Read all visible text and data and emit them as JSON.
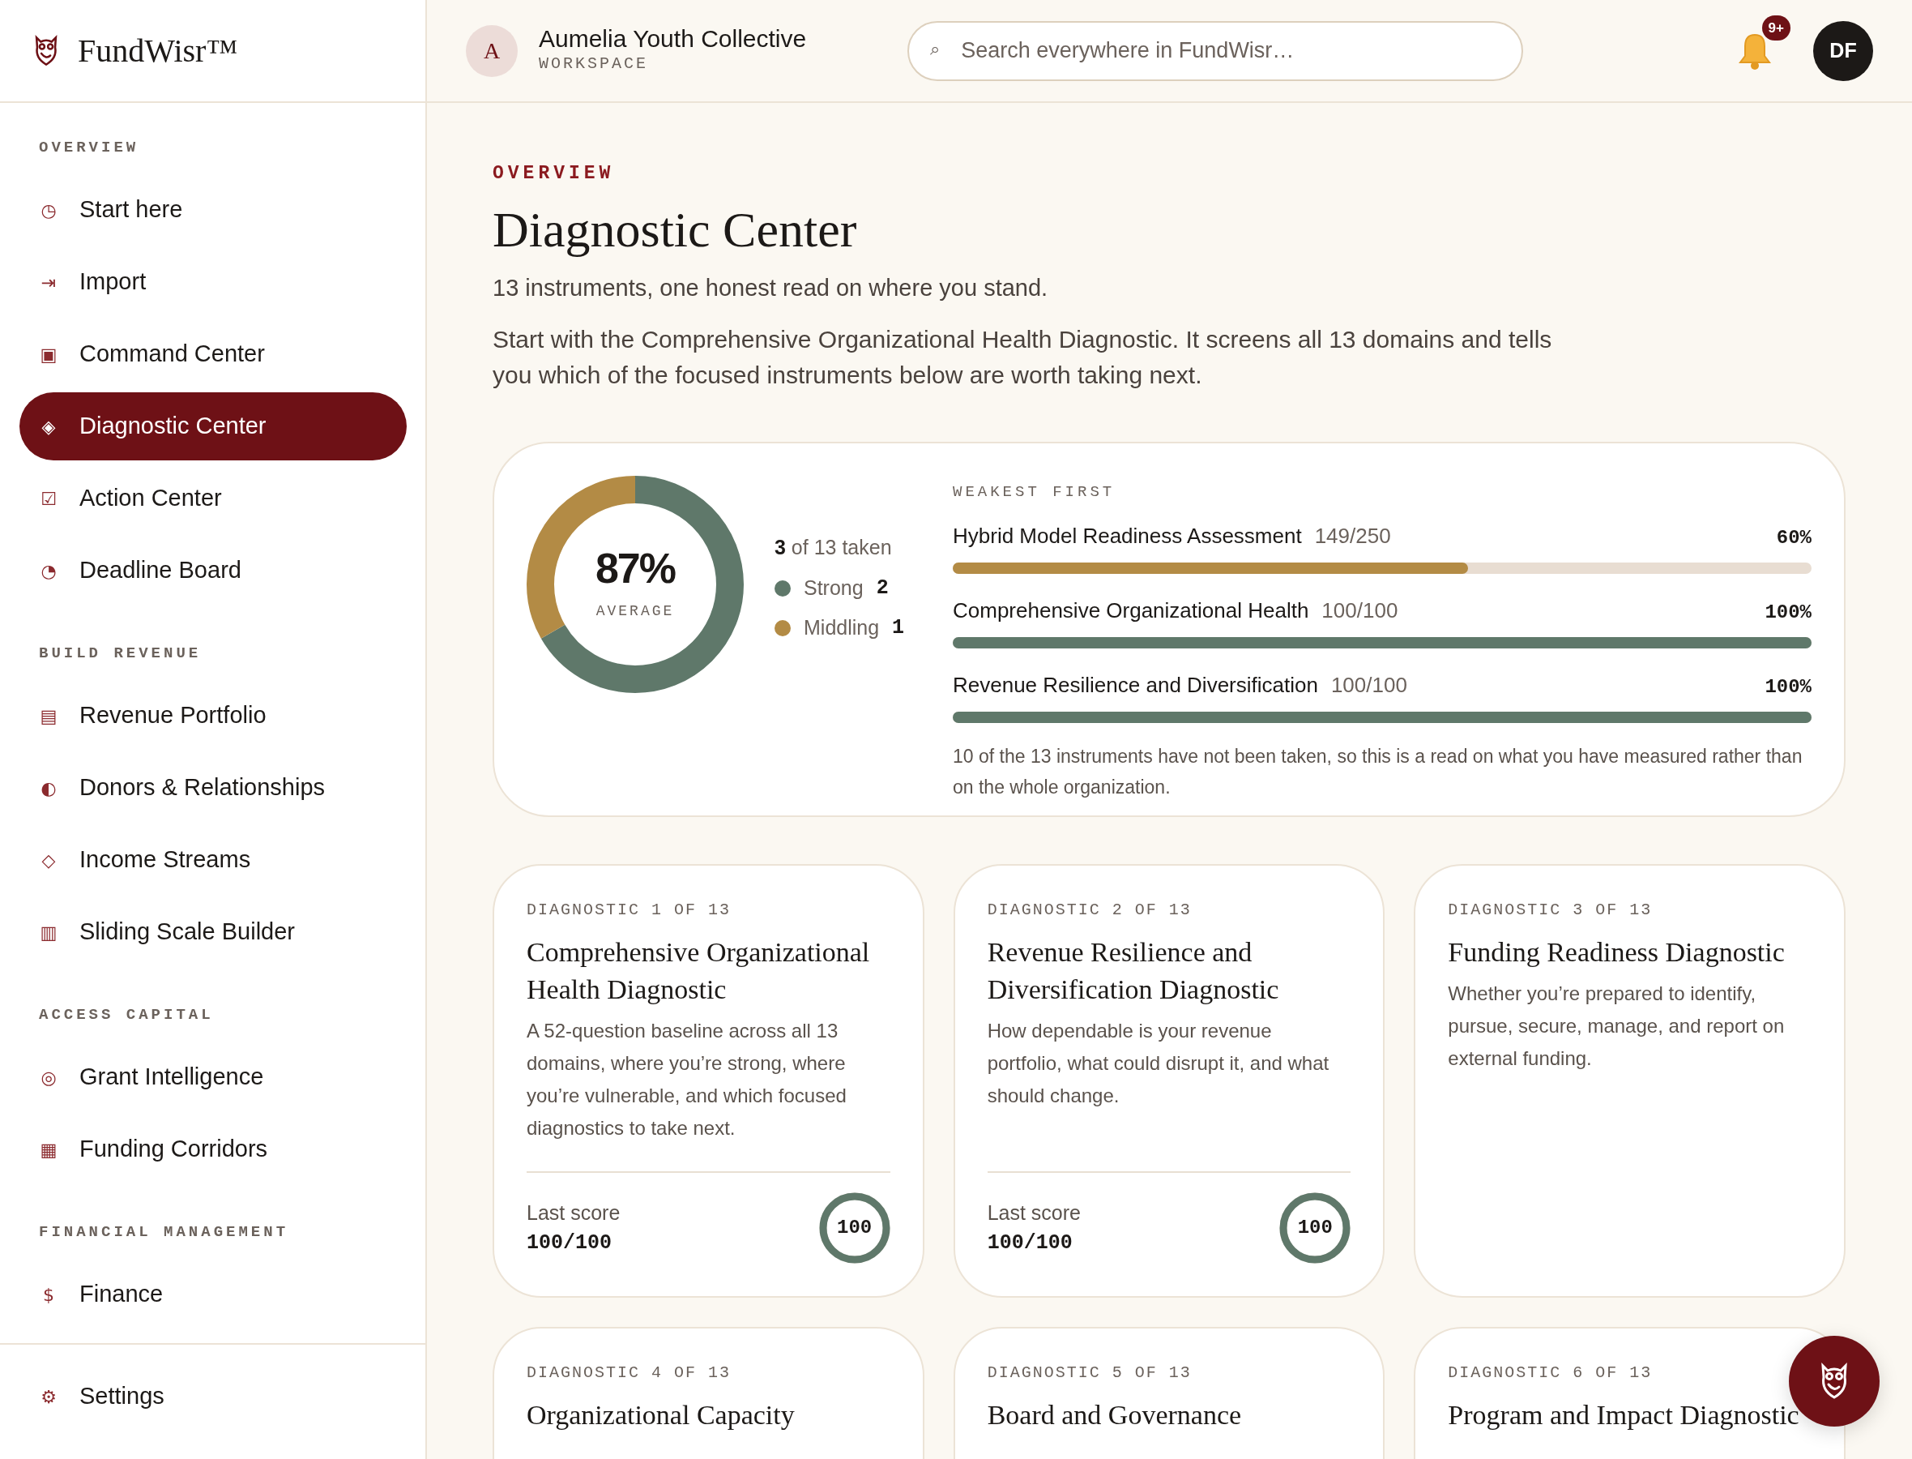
{
  "brand": {
    "name": "FundWisr™"
  },
  "workspace": {
    "initial": "A",
    "name": "Aumelia Youth Collective",
    "label": "WORKSPACE"
  },
  "search": {
    "icon": "⌕",
    "placeholder": "Search everywhere in FundWisr…"
  },
  "notifications": {
    "badge": "9+"
  },
  "user": {
    "initials": "DF"
  },
  "sidebar": {
    "sections": [
      {
        "title": "OVERVIEW",
        "items": [
          {
            "icon": "◷",
            "label": "Start here",
            "selected": false
          },
          {
            "icon": "⇥",
            "label": "Import",
            "selected": false
          },
          {
            "icon": "▣",
            "label": "Command Center",
            "selected": false
          },
          {
            "icon": "◈",
            "label": "Diagnostic Center",
            "selected": true
          },
          {
            "icon": "☑",
            "label": "Action Center",
            "selected": false
          },
          {
            "icon": "◔",
            "label": "Deadline Board",
            "selected": false
          }
        ]
      },
      {
        "title": "BUILD REVENUE",
        "items": [
          {
            "icon": "▤",
            "label": "Revenue Portfolio",
            "selected": false
          },
          {
            "icon": "◐",
            "label": "Donors & Relationships",
            "selected": false
          },
          {
            "icon": "◇",
            "label": "Income Streams",
            "selected": false
          },
          {
            "icon": "▥",
            "label": "Sliding Scale Builder",
            "selected": false
          }
        ]
      },
      {
        "title": "ACCESS CAPITAL",
        "items": [
          {
            "icon": "◎",
            "label": "Grant Intelligence",
            "selected": false
          },
          {
            "icon": "▦",
            "label": "Funding Corridors",
            "selected": false
          }
        ]
      },
      {
        "title": "FINANCIAL MANAGEMENT",
        "items": [
          {
            "icon": "$",
            "label": "Finance",
            "selected": false
          }
        ]
      }
    ],
    "footer": [
      {
        "icon": "⚙",
        "label": "Settings",
        "selected": false
      }
    ]
  },
  "page": {
    "eyebrow": "OVERVIEW",
    "title": "Diagnostic Center",
    "subtitle": "13 instruments, one honest read on where you stand.",
    "intro": "Start with the Comprehensive Organizational Health Diagnostic. It screens all 13 domains and tells you which of the focused instruments below are worth taking next."
  },
  "summary": {
    "average": "87%",
    "average_label": "AVERAGE",
    "taken_count": "3",
    "taken_text": "of 13 taken",
    "legend": [
      {
        "label": "Strong",
        "count": "2",
        "color": "#5f786a"
      },
      {
        "label": "Middling",
        "count": "1",
        "color": "#b38b45"
      }
    ],
    "bars_title": "WEAKEST FIRST",
    "bars": [
      {
        "name": "Hybrid Model Readiness Assessment",
        "score": "149/250",
        "percent": "60%",
        "level": 0.6,
        "color": "#b38b45"
      },
      {
        "name": "Comprehensive Organizational Health",
        "score": "100/100",
        "percent": "100%",
        "level": 1,
        "color": "#5f786a"
      },
      {
        "name": "Revenue Resilience and Diversification",
        "score": "100/100",
        "percent": "100%",
        "level": 1,
        "color": "#5f786a"
      }
    ],
    "note": "10 of the 13 instruments have not been taken, so this is a read on what you have measured rather than on the whole organization."
  },
  "diagnostics": [
    {
      "eyebrow": "DIAGNOSTIC 1 OF 13",
      "title": "Comprehensive Organizational Health Diagnostic",
      "description": "A 52-question baseline across all 13 domains, where you’re strong, where you’re vulnerable, and which focused diagnostics to take next.",
      "last_score_label": "Last score",
      "last_score": "100/100",
      "ring": "100",
      "level": 1
    },
    {
      "eyebrow": "DIAGNOSTIC 2 OF 13",
      "title": "Revenue Resilience and Diversification Diagnostic",
      "description": "How dependable is your revenue portfolio, what could disrupt it, and what should change.",
      "last_score_label": "Last score",
      "last_score": "100/100",
      "ring": "100",
      "level": 1
    },
    {
      "eyebrow": "DIAGNOSTIC 3 OF 13",
      "title": "Funding Readiness Diagnostic",
      "description": "Whether you’re prepared to identify, pursue, secure, manage, and report on external funding."
    },
    {
      "eyebrow": "DIAGNOSTIC 4 OF 13",
      "title": "Organizational Capacity"
    },
    {
      "eyebrow": "DIAGNOSTIC 5 OF 13",
      "title": "Board and Governance"
    },
    {
      "eyebrow": "DIAGNOSTIC 6 OF 13",
      "title": "Program and Impact Diagnostic"
    }
  ]
}
